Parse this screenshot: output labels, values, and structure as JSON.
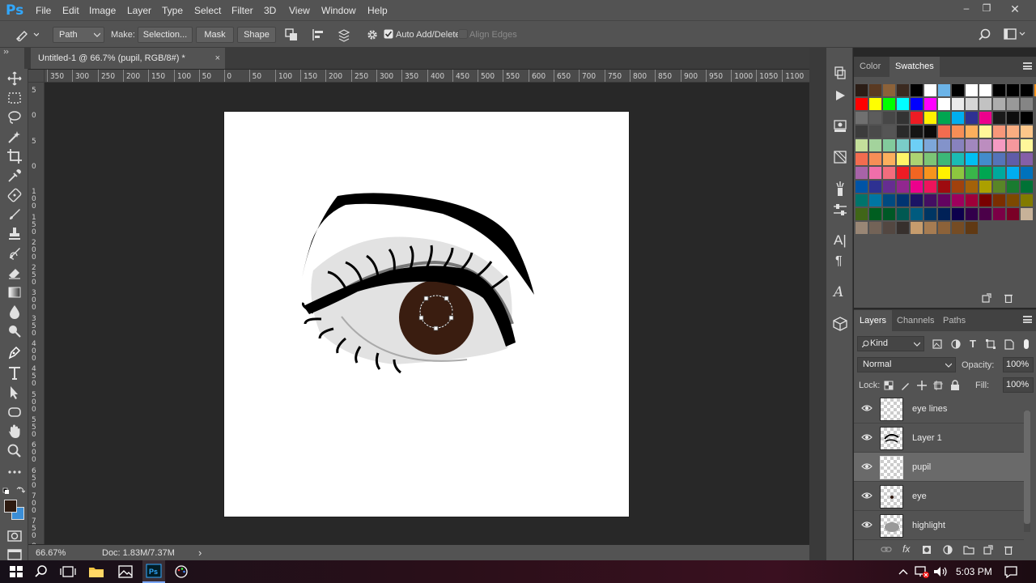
{
  "app": {
    "logo": "Ps"
  },
  "menu": [
    "File",
    "Edit",
    "Image",
    "Layer",
    "Type",
    "Select",
    "Filter",
    "3D",
    "View",
    "Window",
    "Help"
  ],
  "options": {
    "mode": "Path",
    "make_label": "Make:",
    "selection": "Selection...",
    "mask": "Mask",
    "shape": "Shape",
    "auto_add_delete": "Auto Add/Delete",
    "auto_add_delete_checked": true,
    "align_edges": "Align Edges"
  },
  "document": {
    "tab_title": "Untitled-1 @ 66.7% (pupil, RGB/8#) *",
    "close": "×"
  },
  "rulers": {
    "horizontal": [
      "350",
      "300",
      "250",
      "200",
      "150",
      "100",
      "50",
      "0",
      "50",
      "100",
      "150",
      "200",
      "250",
      "300",
      "350",
      "400",
      "450",
      "500",
      "550",
      "600",
      "650",
      "700",
      "750",
      "800",
      "850",
      "900",
      "950",
      "1000",
      "1050",
      "1100"
    ],
    "vertical": [
      "5",
      "0",
      "5",
      "0",
      "1 0 0",
      "1 5 0",
      "2 0 0",
      "2 5 0",
      "3 0 0",
      "3 5 0",
      "4 0 0",
      "4 5 0",
      "5 0 0",
      "5 5 0",
      "6 0 0",
      "6 5 0",
      "7 0 0",
      "7 5 0",
      "8 0 0"
    ]
  },
  "status": {
    "zoom": "66.67%",
    "doc": "Doc: 1.83M/7.37M",
    "arrow": "›"
  },
  "swatch_panel": {
    "tabs": [
      {
        "label": "Color",
        "active": false
      },
      {
        "label": "Swatches",
        "active": true
      }
    ],
    "rows": [
      [
        "#2b1d16",
        "#5a3a22",
        "#8c6239",
        "#3b2a20",
        "#000000",
        "#ffffff",
        "#6cb4e8",
        "#000000",
        "#ffffff",
        "#ffffff",
        "#000000",
        "#000000",
        "#000000",
        "#f7931e"
      ],
      [
        "#ff0000",
        "#ffff00",
        "#00ff00",
        "#00ffff",
        "#0000ff",
        "#ff00ff",
        "#ffffff",
        "#ebebeb",
        "#d6d6d6",
        "#c2c2c2",
        "#adadad",
        "#999999",
        "#858585"
      ],
      [
        "#707070",
        "#5c5c5c",
        "#474747",
        "#333333",
        "#ed1c24",
        "#fff200",
        "#00a651",
        "#00aeef",
        "#2e3192",
        "#ec008c",
        "#1a1a1a",
        "#0d0d0d",
        "#000000"
      ],
      [
        "#3c3c3c",
        "#4a4a4a",
        "#555555",
        "#2a2a2a",
        "#151515",
        "#0a0a0a",
        "#f26c4f",
        "#f68e56",
        "#fbaf5d",
        "#fff799",
        "#f7977a",
        "#f9ad81",
        "#fdc68a"
      ],
      [
        "#c4df9b",
        "#a3d39c",
        "#82ca9c",
        "#7accc8",
        "#6dcff6",
        "#7da7d9",
        "#8393ca",
        "#8882be",
        "#a187be",
        "#bc8dbf",
        "#f49ac2",
        "#f5989d",
        "#fff79a"
      ],
      [
        "#f26c4f",
        "#f68e56",
        "#fbaf5d",
        "#fff568",
        "#acd372",
        "#7cc576",
        "#3bb878",
        "#1abbb4",
        "#00bff3",
        "#438ccb",
        "#5574b9",
        "#605ca8",
        "#855fa8"
      ],
      [
        "#a763a8",
        "#f06eaa",
        "#f26d7d",
        "#ed1c24",
        "#f26522",
        "#f7941d",
        "#fff200",
        "#8dc63f",
        "#39b54a",
        "#00a651",
        "#00a99d",
        "#00aeef",
        "#0072bc"
      ],
      [
        "#0054a6",
        "#2e3192",
        "#662d91",
        "#92278f",
        "#ec008c",
        "#ed145b",
        "#9e0b0f",
        "#a0410d",
        "#a36209",
        "#aba000",
        "#598527",
        "#197b30",
        "#007236"
      ],
      [
        "#00746b",
        "#0076a3",
        "#004a80",
        "#003471",
        "#1b1464",
        "#440e62",
        "#630460",
        "#9e005d",
        "#9e0039",
        "#790000",
        "#7b2e00",
        "#7d4900",
        "#827b00"
      ],
      [
        "#406618",
        "#005e20",
        "#005826",
        "#005952",
        "#005b7f",
        "#003663",
        "#002157",
        "#0d004c",
        "#32004b",
        "#4b0049",
        "#7b0046",
        "#7a0026",
        "#c7b299"
      ],
      [
        "#998675",
        "#736357",
        "#534741",
        "#37302d",
        "#c69c6d",
        "#a67c52",
        "#8c6239",
        "#754c24",
        "#603913"
      ]
    ]
  },
  "layers_panel": {
    "tabs": [
      {
        "label": "Layers",
        "active": true
      },
      {
        "label": "Channels",
        "active": false
      },
      {
        "label": "Paths",
        "active": false
      }
    ],
    "filter_kind": "Kind",
    "blend_mode": "Normal",
    "opacity_label": "Opacity:",
    "opacity": "100%",
    "lock_label": "Lock:",
    "fill_label": "Fill:",
    "fill": "100%",
    "fx_label": "fx",
    "layers": [
      {
        "name": "eye lines",
        "selected": false,
        "thumb": "empty"
      },
      {
        "name": "Layer 1",
        "selected": false,
        "thumb": "brow"
      },
      {
        "name": "pupil",
        "selected": true,
        "thumb": "empty"
      },
      {
        "name": "eye",
        "selected": false,
        "thumb": "dot"
      },
      {
        "name": "highlight",
        "selected": false,
        "thumb": "gray"
      }
    ]
  },
  "taskbar": {
    "time": "5:03 PM"
  },
  "colors": {
    "foreground": "#2d1a10",
    "background": "#3b8ed6",
    "iris": "#3a1d10",
    "selection_accent": "#31a8ff"
  }
}
